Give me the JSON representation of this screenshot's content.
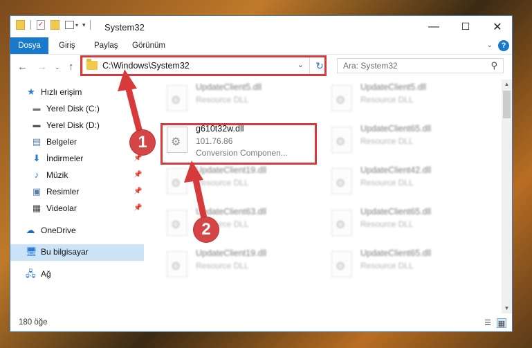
{
  "window": {
    "title": "System32",
    "controls": {
      "minimize": "—",
      "maximize": "☐",
      "close": "✕"
    }
  },
  "ribbon": {
    "tabs": [
      {
        "label": "Dosya",
        "active": true
      },
      {
        "label": "Giriş"
      },
      {
        "label": "Paylaş"
      },
      {
        "label": "Görünüm"
      }
    ],
    "help": "?"
  },
  "nav": {
    "address_path": "C:\\Windows\\System32",
    "search_placeholder": "Ara: System32"
  },
  "sidebar": {
    "items": [
      {
        "label": "Hızlı erişim",
        "icon": "star-icon",
        "pinned": false
      },
      {
        "label": "Yerel Disk (C:)",
        "icon": "drive-icon",
        "pinned": false
      },
      {
        "label": "Yerel Disk (D:)",
        "icon": "drive-icon",
        "pinned": false
      },
      {
        "label": "Belgeler",
        "icon": "documents-icon",
        "pinned": true
      },
      {
        "label": "İndirmeler",
        "icon": "downloads-icon",
        "pinned": true
      },
      {
        "label": "Müzik",
        "icon": "music-icon",
        "pinned": true
      },
      {
        "label": "Resimler",
        "icon": "pictures-icon",
        "pinned": true
      },
      {
        "label": "Videolar",
        "icon": "videos-icon",
        "pinned": true
      },
      {
        "label": "OneDrive",
        "icon": "cloud-icon",
        "pinned": false
      },
      {
        "label": "Bu bilgisayar",
        "icon": "computer-icon",
        "pinned": false,
        "selected": true
      },
      {
        "label": "Ağ",
        "icon": "network-icon",
        "pinned": false
      }
    ]
  },
  "files": [
    {
      "name": "UpdateClient5.dll",
      "line2": "Resource DLL",
      "line3": ""
    },
    {
      "name": "UpdateClient5.dll",
      "line2": "Resource DLL",
      "line3": ""
    },
    {
      "name": "g610t32w.dll",
      "line2": "101.76.86",
      "line3": "Conversion Componen...",
      "highlighted": true
    },
    {
      "name": "UpdateClient65.dll",
      "line2": "Resource DLL",
      "line3": ""
    },
    {
      "name": "UpdateClient19.dll",
      "line2": "Resource DLL",
      "line3": ""
    },
    {
      "name": "UpdateClient42.dll",
      "line2": "Resource DLL",
      "line3": ""
    },
    {
      "name": "UpdateClient63.dll",
      "line2": "Resource DLL",
      "line3": ""
    },
    {
      "name": "UpdateClient65.dll",
      "line2": "Resource DLL",
      "line3": ""
    },
    {
      "name": "UpdateClient19.dll",
      "line2": "Resource DLL",
      "line3": ""
    },
    {
      "name": "UpdateClient65.dll",
      "line2": "Resource DLL",
      "line3": ""
    }
  ],
  "status": {
    "count": "180 öğe"
  },
  "annotations": {
    "step1": "1",
    "step2": "2",
    "color": "#d63a3a"
  }
}
